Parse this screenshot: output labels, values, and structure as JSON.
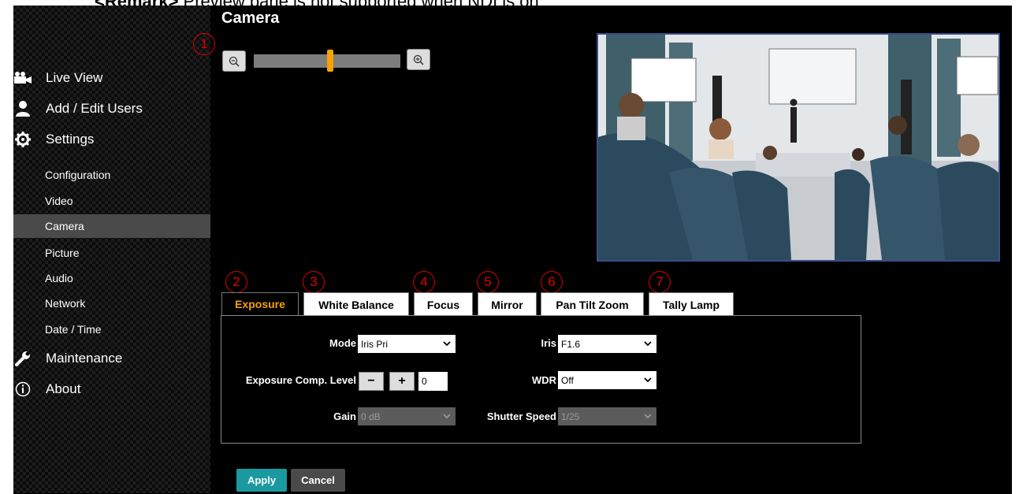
{
  "remark": {
    "prefix": "<Remark>",
    "text": " Preview pane is not supported when NDI is on"
  },
  "page_title": "Camera",
  "sidebar": {
    "main_items": [
      {
        "label": "Live View",
        "icon": "video-camera-icon"
      },
      {
        "label": "Add / Edit Users",
        "icon": "user-icon"
      },
      {
        "label": "Settings",
        "icon": "gear-icon"
      },
      {
        "label": "Maintenance",
        "icon": "wrench-icon"
      },
      {
        "label": "About",
        "icon": "info-icon"
      }
    ],
    "settings_items": [
      "Configuration",
      "Video",
      "Camera",
      "Picture",
      "Audio",
      "Network",
      "Date / Time"
    ],
    "active_item": "Camera"
  },
  "callouts": [
    "1",
    "2",
    "3",
    "4",
    "5",
    "6",
    "7"
  ],
  "zoom": {
    "level": 0.52
  },
  "tabs": [
    "Exposure",
    "White Balance",
    "Focus",
    "Mirror",
    "Pan Tilt Zoom",
    "Tally Lamp"
  ],
  "active_tab": "Exposure",
  "exposure": {
    "mode_label": "Mode",
    "mode_value": "Iris Pri",
    "iris_label": "Iris",
    "iris_value": "F1.6",
    "comp_label": "Exposure Comp. Level",
    "comp_minus": "−",
    "comp_plus": "+",
    "comp_value": "0",
    "wdr_label": "WDR",
    "wdr_value": "Off",
    "gain_label": "Gain",
    "gain_value": "0 dB",
    "shutter_label": "Shutter Speed",
    "shutter_value": "1/25"
  },
  "buttons": {
    "apply": "Apply",
    "cancel": "Cancel"
  },
  "colors": {
    "accent": "#f7a100",
    "apply": "#1a9aa0",
    "cancel": "#4a4a4a",
    "callout": "#e00000"
  }
}
